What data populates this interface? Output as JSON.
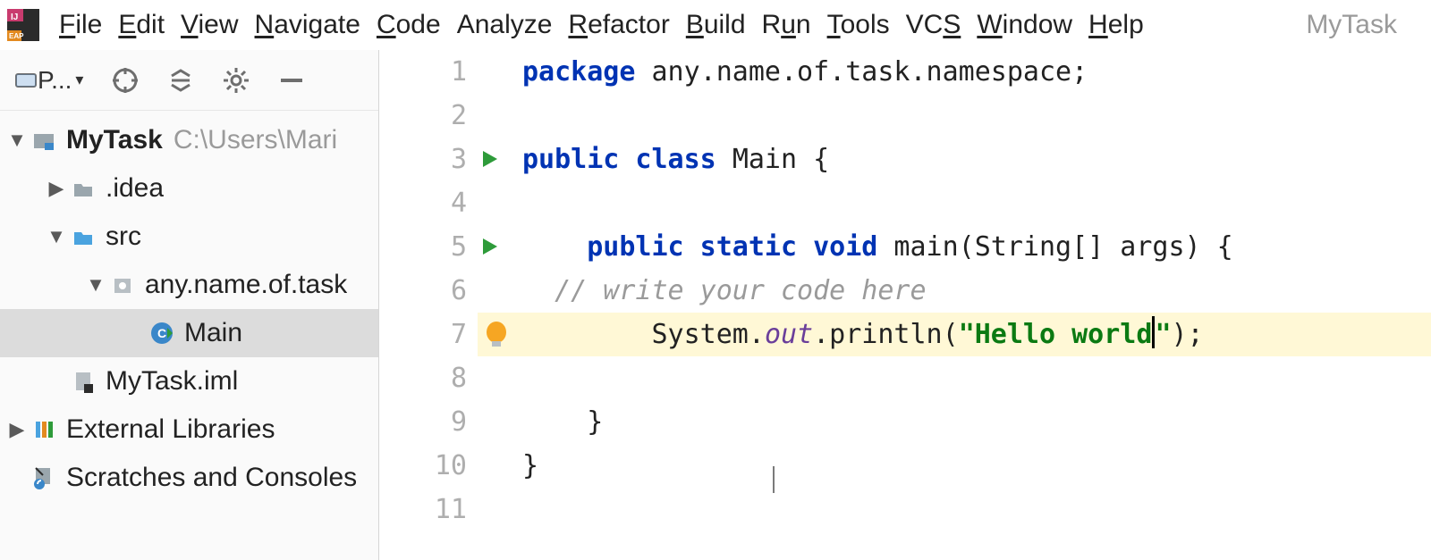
{
  "menu": {
    "items": [
      {
        "label": "File",
        "u": 0
      },
      {
        "label": "Edit",
        "u": 0
      },
      {
        "label": "View",
        "u": 0
      },
      {
        "label": "Navigate",
        "u": 0
      },
      {
        "label": "Code",
        "u": 0
      },
      {
        "label": "Analyze",
        "u": -1
      },
      {
        "label": "Refactor",
        "u": 0
      },
      {
        "label": "Build",
        "u": 0
      },
      {
        "label": "Run",
        "u": 1
      },
      {
        "label": "Tools",
        "u": 0
      },
      {
        "label": "VCS",
        "u": 2
      },
      {
        "label": "Window",
        "u": 0
      },
      {
        "label": "Help",
        "u": 0
      }
    ],
    "project_label": "MyTask"
  },
  "sidebar": {
    "toolbar": {
      "project_label": "P..."
    },
    "rows": [
      {
        "indent": 0,
        "arrow": "down",
        "icon": "project",
        "label": "MyTask",
        "bold": true,
        "path": "C:\\Users\\Mari"
      },
      {
        "indent": 1,
        "arrow": "right",
        "icon": "folder",
        "label": ".idea"
      },
      {
        "indent": 1,
        "arrow": "down",
        "icon": "folder-src",
        "label": "src"
      },
      {
        "indent": 2,
        "arrow": "down",
        "icon": "package",
        "label": "any.name.of.task"
      },
      {
        "indent": 3,
        "arrow": "",
        "icon": "class",
        "label": "Main",
        "selected": true
      },
      {
        "indent": 1,
        "arrow": "",
        "icon": "iml",
        "label": "MyTask.iml"
      },
      {
        "indent": 0,
        "arrow": "right",
        "icon": "libs",
        "label": "External Libraries"
      },
      {
        "indent": 0,
        "arrow": "",
        "icon": "scratches",
        "label": "Scratches and Consoles"
      }
    ]
  },
  "editor": {
    "lines": [
      {
        "n": 1,
        "run": false,
        "hl": false,
        "tokens": [
          [
            "kw",
            "package "
          ],
          [
            "",
            "any.name.of.task.namespace;"
          ]
        ]
      },
      {
        "n": 2,
        "run": false,
        "hl": false,
        "tokens": [
          [
            "",
            ""
          ]
        ]
      },
      {
        "n": 3,
        "run": true,
        "hl": false,
        "tokens": [
          [
            "kw",
            "public class "
          ],
          [
            "",
            "Main {"
          ]
        ]
      },
      {
        "n": 4,
        "run": false,
        "hl": false,
        "tokens": [
          [
            "",
            ""
          ]
        ]
      },
      {
        "n": 5,
        "run": true,
        "hl": false,
        "tokens": [
          [
            "",
            "    "
          ],
          [
            "kw",
            "public static void "
          ],
          [
            "",
            "main(String[] args) {"
          ]
        ]
      },
      {
        "n": 6,
        "run": false,
        "hl": false,
        "tokens": [
          [
            "",
            "  "
          ],
          [
            "cm",
            "// write your code here"
          ]
        ]
      },
      {
        "n": 7,
        "run": false,
        "hl": true,
        "bulb": true,
        "tokens": [
          [
            "",
            "        System."
          ],
          [
            "fld",
            "out"
          ],
          [
            "",
            ".println("
          ],
          [
            "str",
            "\"Hello world"
          ],
          [
            "caret",
            ""
          ],
          [
            "str",
            "\""
          ],
          [
            "",
            ");"
          ]
        ]
      },
      {
        "n": 8,
        "run": false,
        "hl": false,
        "tokens": [
          [
            "",
            ""
          ]
        ]
      },
      {
        "n": 9,
        "run": false,
        "hl": false,
        "tokens": [
          [
            "",
            "    }"
          ]
        ]
      },
      {
        "n": 10,
        "run": false,
        "hl": false,
        "tokens": [
          [
            "",
            "}"
          ]
        ]
      },
      {
        "n": 11,
        "run": false,
        "hl": false,
        "tokens": [
          [
            "",
            ""
          ]
        ]
      }
    ]
  }
}
